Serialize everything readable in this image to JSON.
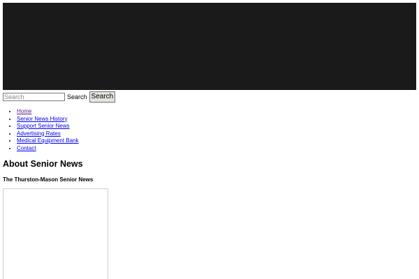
{
  "search": {
    "placeholder": "Search",
    "label": "Search",
    "button_label": "Search"
  },
  "nav": {
    "items": [
      {
        "label": "Home",
        "visited": true
      },
      {
        "label": "Senior News History",
        "visited": false
      },
      {
        "label": "Support Senior News",
        "visited": false
      },
      {
        "label": "Advertising Rates",
        "visited": false
      },
      {
        "label": "Medical Equipment Bank",
        "visited": false
      },
      {
        "label": "Contact",
        "visited": false
      }
    ]
  },
  "main": {
    "title": "About Senior News",
    "subtitle": "The Thurston-Mason Senior News"
  },
  "colors": {
    "header_background": "#1a1a1a",
    "link": "#0000ee",
    "visited_link": "#551a8b"
  }
}
